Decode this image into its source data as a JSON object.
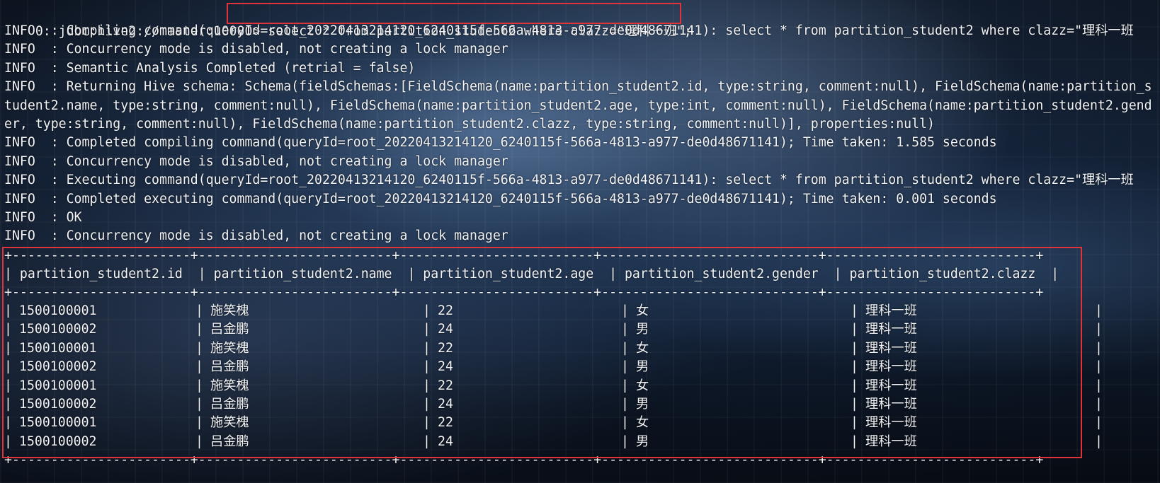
{
  "prompt": "0: jdbc:hive2://master:10000>",
  "query": "select * from partition_student2 where clazz=\"理科一班\";",
  "log_lines": [
    "INFO  : Compiling command(queryId=root_20220413214120_6240115f-566a-4813-a977-de0d48671141): select * from partition_student2 where clazz=\"理科一班",
    "INFO  : Concurrency mode is disabled, not creating a lock manager",
    "INFO  : Semantic Analysis Completed (retrial = false)",
    "INFO  : Returning Hive schema: Schema(fieldSchemas:[FieldSchema(name:partition_student2.id, type:string, comment:null), FieldSchema(name:partition_s",
    "tudent2.name, type:string, comment:null), FieldSchema(name:partition_student2.age, type:int, comment:null), FieldSchema(name:partition_student2.gend",
    "er, type:string, comment:null), FieldSchema(name:partition_student2.clazz, type:string, comment:null)], properties:null)",
    "INFO  : Completed compiling command(queryId=root_20220413214120_6240115f-566a-4813-a977-de0d48671141); Time taken: 1.585 seconds",
    "INFO  : Concurrency mode is disabled, not creating a lock manager",
    "INFO  : Executing command(queryId=root_20220413214120_6240115f-566a-4813-a977-de0d48671141): select * from partition_student2 where clazz=\"理科一班",
    "INFO  : Completed executing command(queryId=root_20220413214120_6240115f-566a-4813-a977-de0d48671141); Time taken: 0.001 seconds",
    "INFO  : OK",
    "INFO  : Concurrency mode is disabled, not creating a lock manager"
  ],
  "table": {
    "border": "+-----------------------+-------------------------+-------------------------+----------------------------+---------------------------+",
    "headers": [
      "| partition_student2.id  | partition_student2.name  | partition_student2.age  | partition_student2.gender  | partition_student2.clazz  |"
    ],
    "rows": [
      [
        "1500100001",
        "施笑槐",
        "22",
        "女",
        "理科一班"
      ],
      [
        "1500100002",
        "吕金鹏",
        "24",
        "男",
        "理科一班"
      ],
      [
        "1500100001",
        "施笑槐",
        "22",
        "女",
        "理科一班"
      ],
      [
        "1500100002",
        "吕金鹏",
        "24",
        "男",
        "理科一班"
      ],
      [
        "1500100001",
        "施笑槐",
        "22",
        "女",
        "理科一班"
      ],
      [
        "1500100002",
        "吕金鹏",
        "24",
        "男",
        "理科一班"
      ],
      [
        "1500100001",
        "施笑槐",
        "22",
        "女",
        "理科一班"
      ],
      [
        "1500100002",
        "吕金鹏",
        "24",
        "男",
        "理科一班"
      ]
    ],
    "separator": "|"
  },
  "colors": {
    "text": "#f2f4f7",
    "highlight": "#e0343a"
  }
}
